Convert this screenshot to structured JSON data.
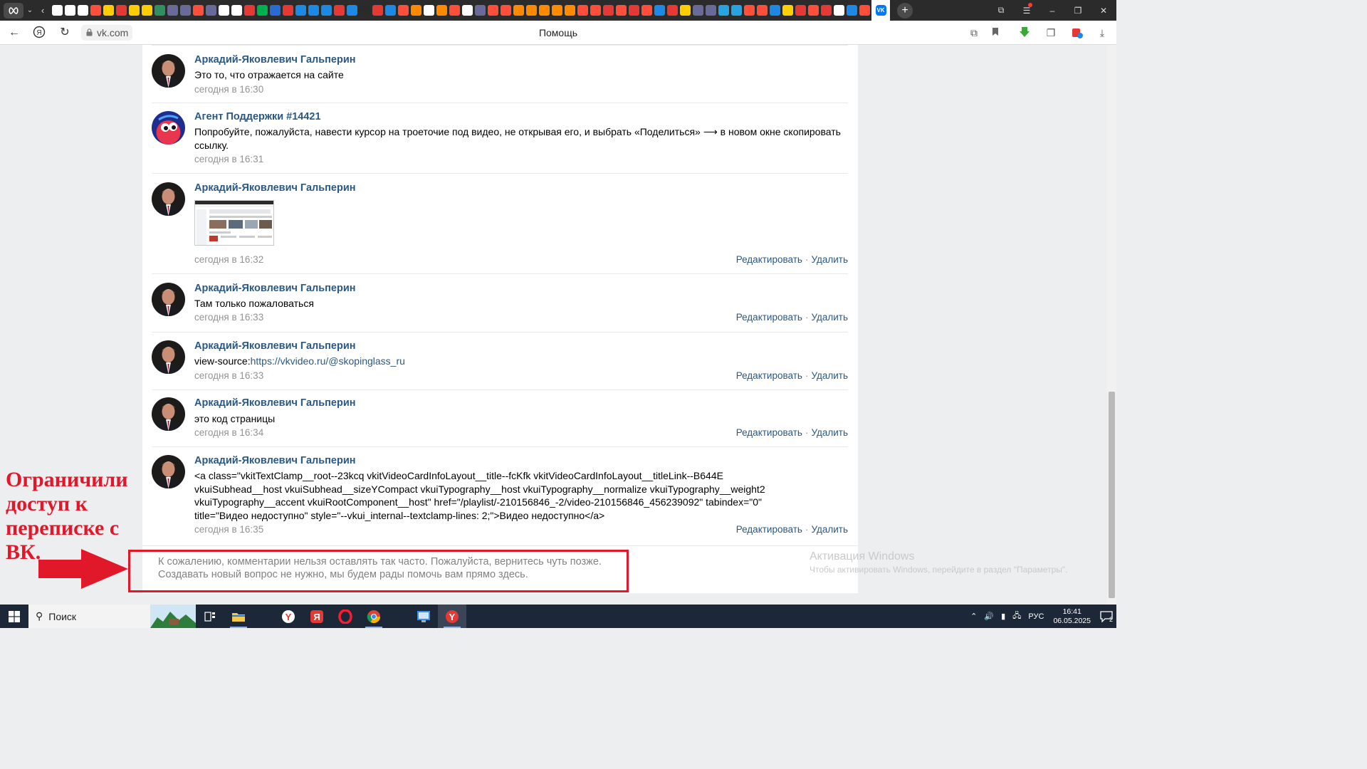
{
  "browser": {
    "url": "vk.com",
    "page_title": "Помощь",
    "tab_icon_colors": [
      "#ffffff",
      "#ffffff",
      "#ffffff",
      "#ff4f3a",
      "#ffcc00",
      "#e53935",
      "#ffcc00",
      "#ffcc00",
      "#2f8f5e",
      "#6a6a9a",
      "#6a6a9a",
      "#ff4f3a",
      "#6a6a9a",
      "#ffffff",
      "#ffffff",
      "#e53935",
      "#00b04f",
      "#2a6ad3",
      "#e53935",
      "#1e88e5",
      "#1e88e5",
      "#1e88e5",
      "#e53935",
      "#1e88e5",
      "#2a2a2a",
      "#e53935",
      "#1e88e5",
      "#ff4f3a",
      "#ff8a00",
      "#ffffff",
      "#ff8a00",
      "#ff4f3a",
      "#ffffff",
      "#6a6a9a",
      "#ff4f3a",
      "#ff4f3a",
      "#ff8a00",
      "#ff8a00",
      "#ff8a00",
      "#ff8a00",
      "#ff8a00",
      "#ff4f3a",
      "#ff4f3a",
      "#e53935",
      "#ff4f3a",
      "#e53935",
      "#ff4f3a",
      "#1e88e5",
      "#e53935",
      "#ffcc00",
      "#6a6a9a",
      "#6a6a9a",
      "#29a3e0",
      "#29a3e0",
      "#ff4f3a",
      "#ff4f3a",
      "#1e88e5",
      "#ffd000",
      "#e53935",
      "#ff4f3a",
      "#e53935",
      "#ffffff",
      "#1e88e5",
      "#ff4f3a"
    ],
    "active_tab_label": "VK"
  },
  "messages": [
    {
      "author": "Аркадий-Яковлевич Гальперин",
      "text": "Это то, что отражается на сайте",
      "time": "сегодня в 16:30",
      "avatar": "user"
    },
    {
      "author": "Агент Поддержки #14421",
      "text": "Попробуйте, пожалуйста, навести курсор на троеточие под видео, не открывая его, и выбрать «Поделиться» ⟶ в новом окне скопировать ссылку.",
      "time": "сегодня в 16:31",
      "avatar": "agent"
    },
    {
      "author": "Аркадий-Яковлевич Гальперин",
      "text": "",
      "time": "сегодня в 16:32",
      "avatar": "user",
      "edit": "Редактировать",
      "delete": "Удалить",
      "has_image": true
    },
    {
      "author": "Аркадий-Яковлевич Гальперин",
      "text": "Там только пожаловаться",
      "time": "сегодня в 16:33",
      "avatar": "user",
      "edit": "Редактировать",
      "delete": "Удалить"
    },
    {
      "author": "Аркадий-Яковлевич Гальперин",
      "text_prefix": "view-source:",
      "text_link": "https://vkvideo.ru/@skopinglass_ru",
      "time": "сегодня в 16:33",
      "avatar": "user",
      "edit": "Редактировать",
      "delete": "Удалить"
    },
    {
      "author": "Аркадий-Яковлевич Гальперин",
      "text": "это код страницы",
      "time": "сегодня в 16:34",
      "avatar": "user",
      "edit": "Редактировать",
      "delete": "Удалить"
    },
    {
      "author": "Аркадий-Яковлевич Гальперин",
      "text": "<a class=\"vkitTextClamp__root--23kcq vkitVideoCardInfoLayout__title--fcKfk vkitVideoCardInfoLayout__titleLink--B644E vkuiSubhead__host vkuiSubhead__sizeYCompact vkuiTypography__host vkuiTypography__normalize vkuiTypography__weight2 vkuiTypography__accent vkuiRootComponent__host\" href=\"/playlist/-210156846_-2/video-210156846_456239092\" tabindex=\"0\" title=\"Видео недоступно\" style=\"--vkui_internal--textclamp-lines: 2;\">Видео недоступно</a>",
      "time": "сегодня в 16:35",
      "avatar": "user",
      "edit": "Редактировать",
      "delete": "Удалить"
    }
  ],
  "notice": {
    "line1": "К сожалению, комментарии нельзя оставлять так часто. Пожалуйста, вернитесь чуть позже.",
    "line2": "Создавать новый вопрос не нужно, мы будем рады помочь вам прямо здесь."
  },
  "annotation": {
    "text": "Ограничили доступ к переписке с ВК.",
    "color": "#e1182a"
  },
  "windows_activation": {
    "title": "Активация Windows",
    "subtitle": "Чтобы активировать Windows, перейдите в раздел \"Параметры\"."
  },
  "taskbar": {
    "search_label": "Поиск",
    "language": "РУС",
    "time": "16:41",
    "date": "06.05.2025",
    "notifications": "2"
  }
}
